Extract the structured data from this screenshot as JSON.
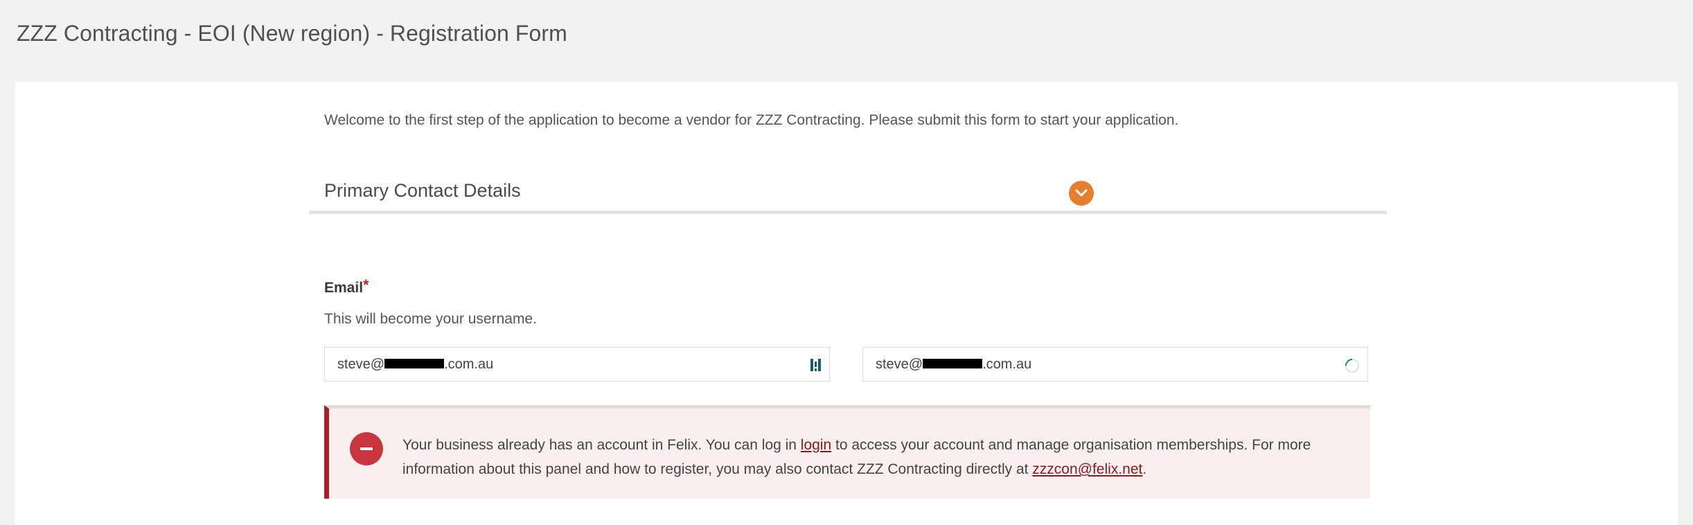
{
  "page": {
    "title": "ZZZ Contracting - EOI (New region) - Registration Form"
  },
  "form": {
    "intro": "Welcome to the first step of the application to become a vendor for ZZZ Contracting. Please submit this form to start your application.",
    "section_title": "Primary Contact Details",
    "email": {
      "label": "Email",
      "required_mark": "*",
      "helper": "This will become your username.",
      "value_prefix": "steve@",
      "value_suffix": ".com.au",
      "confirm_prefix": "steve@",
      "confirm_suffix": ".com.au"
    },
    "alert": {
      "text_before_login": "Your business already has an account in Felix. You can log in ",
      "login_link": "login",
      "text_after_login": " to access your account and manage organisation memberships. For more information about this panel and how to register, you may also contact ZZZ Contracting directly at ",
      "email_link": "zzzcon@felix.net",
      "text_end": "."
    }
  },
  "colors": {
    "accent": "#e57f2f",
    "error": "#c9353d",
    "error_border": "#a81f2a",
    "error_bg": "#f9efef"
  },
  "icons": {
    "section_toggle": "chevron-down-icon",
    "field1": "password-manager-icon",
    "field2": "loading-spinner-icon",
    "alert": "error-minus-icon"
  }
}
